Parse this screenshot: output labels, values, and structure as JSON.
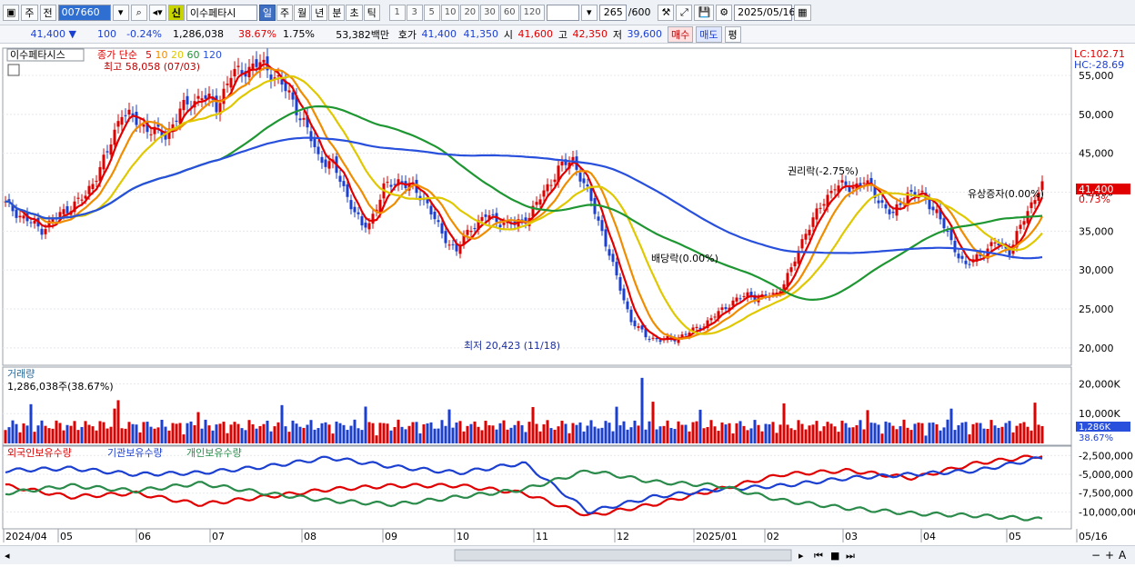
{
  "toolbar": {
    "period_type": "주",
    "prev": "전",
    "code": "007660",
    "stock_name": "이수페타시",
    "credit": "신",
    "intervals": [
      "일",
      "주",
      "월",
      "년",
      "분",
      "초",
      "틱"
    ],
    "active_interval": "일",
    "nums": [
      "1",
      "3",
      "5",
      "10",
      "20",
      "30",
      "60",
      "120"
    ],
    "count": "265",
    "count_total": "/600",
    "date": "2025/05/16"
  },
  "quote": {
    "price": "41,400 ▼",
    "change": "100",
    "change_pct": "-0.24%",
    "volume": "1,286,038",
    "turnover": "38.67%",
    "ratio": "1.75%",
    "amount": "53,382백만",
    "bid_label": "호가",
    "bid": "41,400",
    "ask": "41,350",
    "open_label": "시",
    "open": "41,600",
    "high_label": "고",
    "high": "42,350",
    "low_label": "저",
    "low": "39,600",
    "buy_btn": "매수",
    "sell_btn": "매도",
    "avg_btn": "평"
  },
  "legend": {
    "name": "이수페타시스",
    "ma_label": "종가 단순",
    "ma_periods": [
      "5",
      "10",
      "20",
      "60",
      "120"
    ],
    "ma_colors": [
      "#e00000",
      "#f08c00",
      "#e0c800",
      "#1e9632",
      "#2850dc"
    ]
  },
  "annotations": {
    "high": "최고 58,058 (07/03)",
    "low": "최저 20,423 (11/18)",
    "div1": "배당락(0.00%)",
    "div2": "권리락(-2.75%)",
    "rights": "유상증자(0.00%)",
    "lc": "LC:102.71",
    "hc": "HC:-28.69",
    "price_tag": "41,400",
    "price_pct": "0.73%"
  },
  "volume_panel": {
    "title": "거래량",
    "value": "1,286,038주(38.67%)",
    "tag": "1,286K",
    "tag_pct": "38.67%"
  },
  "holdings_panel": {
    "s1": "외국인보유수량",
    "s2": "기관보유수량",
    "s3": "개인보유수량"
  },
  "chart_data": {
    "type": "candlestick",
    "price_axis": {
      "ticks": [
        55000,
        50000,
        45000,
        40000,
        35000,
        30000,
        25000,
        20000
      ],
      "labels": [
        "55,000",
        "50,000",
        "45,000",
        "40,000",
        "35,000",
        "30,000",
        "25,000",
        "20,000"
      ],
      "ylim": [
        18000,
        58500
      ]
    },
    "volume_axis": {
      "ticks": [
        20000,
        10000
      ],
      "labels": [
        "20,000K",
        "10,000K"
      ]
    },
    "holdings_axis": {
      "ticks": [
        -2500000,
        -5000000,
        -7500000,
        -10000000
      ],
      "labels": [
        "-2,500,000",
        "-5,000,000",
        "-7,500,000",
        "-10,000,000"
      ]
    },
    "x_labels": [
      "2024/04",
      "05",
      "06",
      "07",
      "08",
      "09",
      "10",
      "11",
      "12",
      "2025/01",
      "02",
      "03",
      "04",
      "05",
      "05/16"
    ],
    "close_keypoints": [
      [
        0,
        38500
      ],
      [
        4,
        37000
      ],
      [
        10,
        35200
      ],
      [
        16,
        37500
      ],
      [
        22,
        39500
      ],
      [
        28,
        45000
      ],
      [
        32,
        50500
      ],
      [
        36,
        49000
      ],
      [
        40,
        48000
      ],
      [
        44,
        47200
      ],
      [
        48,
        50500
      ],
      [
        54,
        52500
      ],
      [
        58,
        51000
      ],
      [
        62,
        55000
      ],
      [
        66,
        55800
      ],
      [
        70,
        56500
      ],
      [
        74,
        55000
      ],
      [
        78,
        52500
      ],
      [
        82,
        49000
      ],
      [
        86,
        44500
      ],
      [
        90,
        43500
      ],
      [
        94,
        39500
      ],
      [
        98,
        35500
      ],
      [
        100,
        36000
      ],
      [
        104,
        40500
      ],
      [
        108,
        41500
      ],
      [
        112,
        40500
      ],
      [
        116,
        38500
      ],
      [
        120,
        34500
      ],
      [
        124,
        32500
      ],
      [
        128,
        35500
      ],
      [
        132,
        37000
      ],
      [
        136,
        36200
      ],
      [
        140,
        35800
      ],
      [
        144,
        37000
      ],
      [
        148,
        40000
      ],
      [
        152,
        43000
      ],
      [
        156,
        44200
      ],
      [
        160,
        40000
      ],
      [
        164,
        35000
      ],
      [
        168,
        29000
      ],
      [
        172,
        23500
      ],
      [
        176,
        21500
      ],
      [
        180,
        21000
      ],
      [
        184,
        21200
      ],
      [
        188,
        22000
      ],
      [
        192,
        23000
      ],
      [
        196,
        24500
      ],
      [
        200,
        26000
      ],
      [
        204,
        26800
      ],
      [
        208,
        26500
      ],
      [
        212,
        27000
      ],
      [
        216,
        30000
      ],
      [
        220,
        35000
      ],
      [
        224,
        38000
      ],
      [
        228,
        41000
      ],
      [
        232,
        40500
      ],
      [
        236,
        41500
      ],
      [
        240,
        39000
      ],
      [
        244,
        37000
      ],
      [
        248,
        40000
      ],
      [
        252,
        39500
      ],
      [
        256,
        37500
      ],
      [
        260,
        33500
      ],
      [
        264,
        30500
      ],
      [
        268,
        32000
      ],
      [
        272,
        33500
      ],
      [
        276,
        32500
      ],
      [
        280,
        36500
      ],
      [
        284,
        40500
      ],
      [
        285,
        41400
      ]
    ],
    "ma_periods": [
      5,
      10,
      20,
      60,
      120
    ],
    "holdings": {
      "foreign": [
        -6500000,
        -8000000,
        -7500000,
        -9000000,
        -8000000,
        -7000000,
        -6500000,
        -6500000,
        -7500000,
        -10500000,
        -9000000,
        -7000000,
        -5000000,
        -4500000,
        -5500000,
        -3500000,
        -2500000
      ],
      "institution": [
        -4500000,
        -4200000,
        -5000000,
        -4800000,
        -4000000,
        -2800000,
        -4000000,
        -4800000,
        -3500000,
        -10000000,
        -8000000,
        -7000000,
        -6500000,
        -5500000,
        -5000000,
        -4500000,
        -2800000
      ],
      "individual": [
        -7500000,
        -6500000,
        -7200000,
        -6200000,
        -7500000,
        -8500000,
        -9000000,
        -8000000,
        -7000000,
        -4500000,
        -6000000,
        -6500000,
        -8500000,
        -9500000,
        -10200000,
        -10500000,
        -11000000
      ]
    }
  }
}
